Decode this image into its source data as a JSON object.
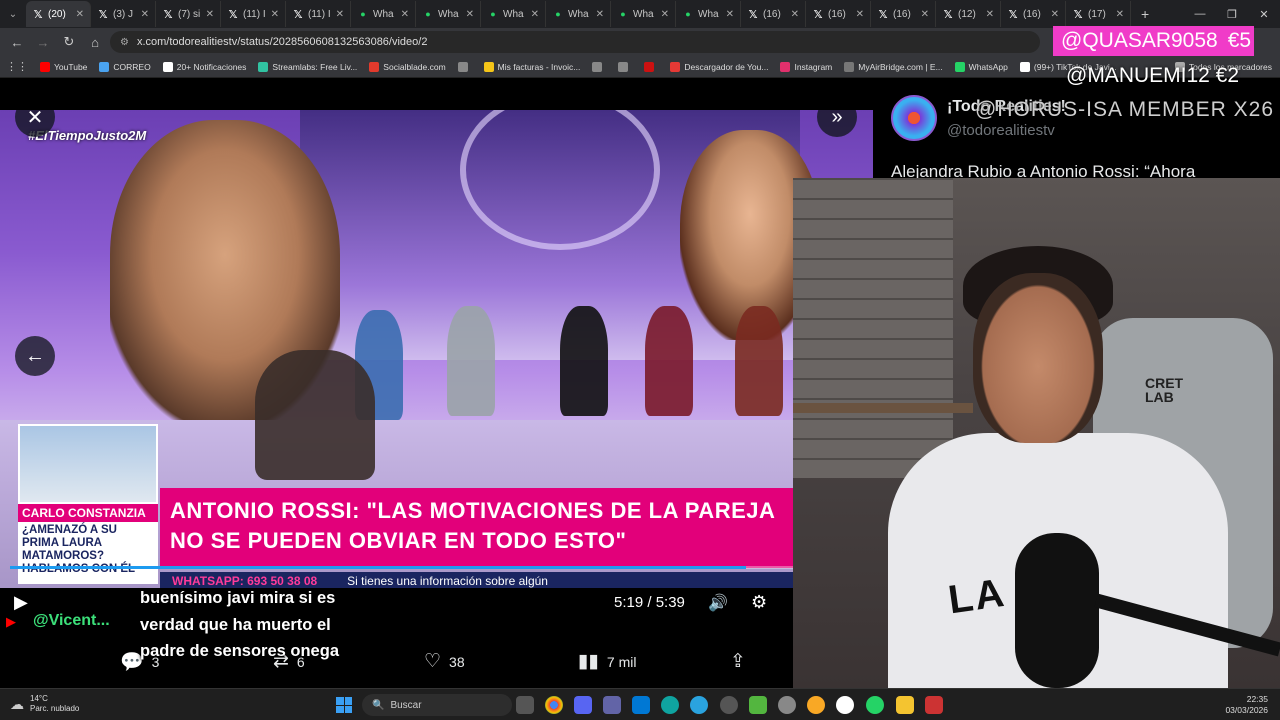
{
  "tabs": [
    {
      "icon": "X",
      "label": "(20) ",
      "active": true
    },
    {
      "icon": "X",
      "label": "(3) J"
    },
    {
      "icon": "X",
      "label": "(7) si"
    },
    {
      "icon": "X",
      "label": "(11) I"
    },
    {
      "icon": "X",
      "label": "(11) I"
    },
    {
      "icon": "wa",
      "label": "Wha"
    },
    {
      "icon": "wa",
      "label": "Wha"
    },
    {
      "icon": "wa",
      "label": "Wha"
    },
    {
      "icon": "wa",
      "label": "Wha"
    },
    {
      "icon": "wa",
      "label": "Wha"
    },
    {
      "icon": "wa",
      "label": "Wha"
    },
    {
      "icon": "X",
      "label": "(16)"
    },
    {
      "icon": "X",
      "label": "(16)"
    },
    {
      "icon": "X",
      "label": "(16)"
    },
    {
      "icon": "X",
      "label": "(12)"
    },
    {
      "icon": "X",
      "label": "(16)"
    },
    {
      "icon": "X",
      "label": "(17)"
    }
  ],
  "address": {
    "url": "x.com/todorealitiestv/status/2028560608132563086/video/2"
  },
  "bookmarks": [
    {
      "label": "YouTube",
      "color": "#ff0000"
    },
    {
      "label": "CORREO",
      "color": "#4aa3f0"
    },
    {
      "label": "20+ Notificaciones",
      "color": "#ffffff"
    },
    {
      "label": "Streamlabs: Free Liv...",
      "color": "#31c3a2"
    },
    {
      "label": "Socialblade.com",
      "color": "#e23a2c"
    },
    {
      "label": "",
      "color": "#888888"
    },
    {
      "label": "Mis facturas - Invoic...",
      "color": "#f5c518"
    },
    {
      "label": "",
      "color": "#888888"
    },
    {
      "label": "",
      "color": "#888888"
    },
    {
      "label": "",
      "color": "#cc1111"
    },
    {
      "label": "Descargador de You...",
      "color": "#e53935"
    },
    {
      "label": "Instagram",
      "color": "#e1306c"
    },
    {
      "label": "MyAirBridge.com | E...",
      "color": "#777777"
    },
    {
      "label": "WhatsApp",
      "color": "#25d366"
    },
    {
      "label": "(99+) TikTok de Javi...",
      "color": "#ffffff"
    },
    {
      "label": "Todos los marcadores",
      "color": "#aaaaaa"
    }
  ],
  "video": {
    "hashtag": "#ElTiempoJusto2M",
    "inset_name": "CARLO CONSTANZIA",
    "inset_question": "¿AMENAZÓ A SU PRIMA LAURA MATAMOROS? HABLAMOS CON ÉL",
    "headline": "ANTONIO ROSSI: \"LAS MOTIVACIONES DE LA PAREJA NO SE PUEDEN OBVIAR EN TODO ESTO\"",
    "ticker_whatsapp": "WHATSAPP: 693 50 38 08",
    "ticker_text": "Si tienes una información sobre algún",
    "time": "5:19 / 5:39",
    "progress_fraction": 0.94
  },
  "actions": {
    "replies": "3",
    "reposts": "6",
    "likes": "38",
    "views": "7 mil"
  },
  "tweet": {
    "display_name": "¡Todo Realities!",
    "handle": "@todorealitiestv",
    "text": "Alejandra Rubio a Antonio Rossi: “Ahora"
  },
  "overlay": {
    "donation1": "@QUASAR9058",
    "donation1_amount": "€5",
    "donation2": "@MANUEMI12 €2",
    "member": "@HORUS-ISA  MEMBER X26",
    "chair_brand": "CRET\nLAB",
    "shirt_text": "LA STA"
  },
  "chat": {
    "username": "@Vicent...",
    "message": "buenísimo javi mira si es verdad que ha muerto el padre de sensores onega"
  },
  "taskbar": {
    "temp": "14°C",
    "weather": "Parc. nublado",
    "search": "Buscar",
    "time": "22:35",
    "date": "03/03/2026"
  }
}
